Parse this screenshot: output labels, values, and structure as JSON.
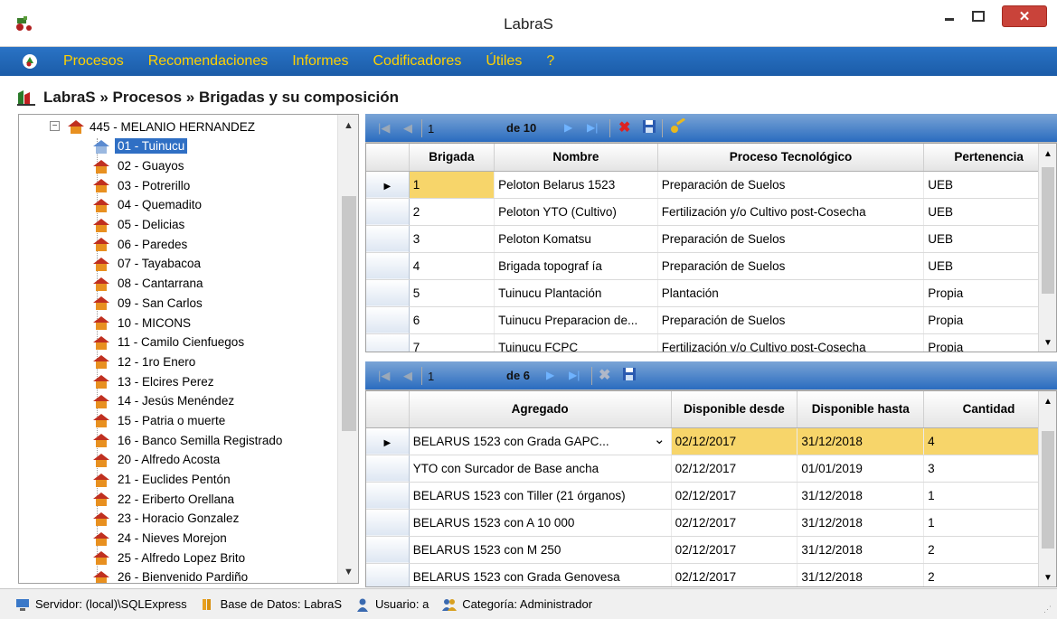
{
  "window": {
    "title": "LabraS"
  },
  "menu": {
    "items": [
      "Procesos",
      "Recomendaciones",
      "Informes",
      "Codificadores",
      "Útiles",
      "?"
    ]
  },
  "breadcrumb": {
    "text": "LabraS » Procesos » Brigadas y su composición"
  },
  "tree": {
    "root": "445 - MELANIO HERNANDEZ",
    "items": [
      "01 - Tuinucu",
      "02 - Guayos",
      "03 - Potrerillo",
      "04 - Quemadito",
      "05 - Delicias",
      "06 - Paredes",
      "07 - Tayabacoa",
      "08 - Cantarrana",
      "09 - San Carlos",
      "10 - MICONS",
      "11 - Camilo Cienfuegos",
      "12 - 1ro Enero",
      "13 - Elcires Perez",
      "14 - Jesús Menéndez",
      "15 - Patria o muerte",
      "16 - Banco Semilla Registrado",
      "20 - Alfredo Acosta",
      "21 - Euclides Pentón",
      "22 - Eriberto Orellana",
      "23 - Horacio Gonzalez",
      "24 - Nieves Morejon",
      "25 - Alfredo Lopez Brito",
      "26 - Bienvenido Pardiño"
    ],
    "selected_index": 0
  },
  "grid1": {
    "nav": {
      "position": "1",
      "count": "de 10"
    },
    "columns": [
      "Brigada",
      "Nombre",
      "Proceso Tecnológico",
      "Pertenencia"
    ],
    "rows": [
      [
        "1",
        "Peloton Belarus 1523",
        "Preparación de Suelos",
        "UEB"
      ],
      [
        "2",
        "Peloton YTO (Cultivo)",
        "Fertilización y/o Cultivo post-Cosecha",
        "UEB"
      ],
      [
        "3",
        "Peloton Komatsu",
        "Preparación de Suelos",
        "UEB"
      ],
      [
        "4",
        "Brigada topograf ía",
        "Preparación de Suelos",
        "UEB"
      ],
      [
        "5",
        "Tuinucu Plantación",
        "Plantación",
        "Propia"
      ],
      [
        "6",
        "Tuinucu Preparacion de...",
        "Preparación de Suelos",
        "Propia"
      ],
      [
        "7",
        "Tuinucu FCPC",
        "Fertilización y/o Cultivo post-Cosecha",
        "Propia"
      ]
    ]
  },
  "grid2": {
    "nav": {
      "position": "1",
      "count": "de 6"
    },
    "columns": [
      "Agregado",
      "Disponible desde",
      "Disponible hasta",
      "Cantidad"
    ],
    "rows": [
      [
        "BELARUS 1523 con Grada GAPC...",
        "02/12/2017",
        "31/12/2018",
        "4"
      ],
      [
        "YTO con Surcador de Base ancha",
        "02/12/2017",
        "01/01/2019",
        "3"
      ],
      [
        "BELARUS 1523 con Tiller (21 órganos)",
        "02/12/2017",
        "31/12/2018",
        "1"
      ],
      [
        "BELARUS 1523 con A 10 000",
        "02/12/2017",
        "31/12/2018",
        "1"
      ],
      [
        "BELARUS 1523 con M 250",
        "02/12/2017",
        "31/12/2018",
        "2"
      ],
      [
        "BELARUS 1523 con Grada Genovesa",
        "02/12/2017",
        "31/12/2018",
        "2"
      ]
    ]
  },
  "status": {
    "server": "Servidor: (local)\\SQLExpress",
    "database": "Base de Datos: LabraS",
    "user": "Usuario: a",
    "category": "Categoría: Administrador"
  },
  "colors": {
    "menu_bg": "#1b5ca8",
    "menu_text": "#ffd100",
    "selection": "#2f6fc4",
    "current_cell": "#f7d56a",
    "close_btn": "#c9433a"
  }
}
